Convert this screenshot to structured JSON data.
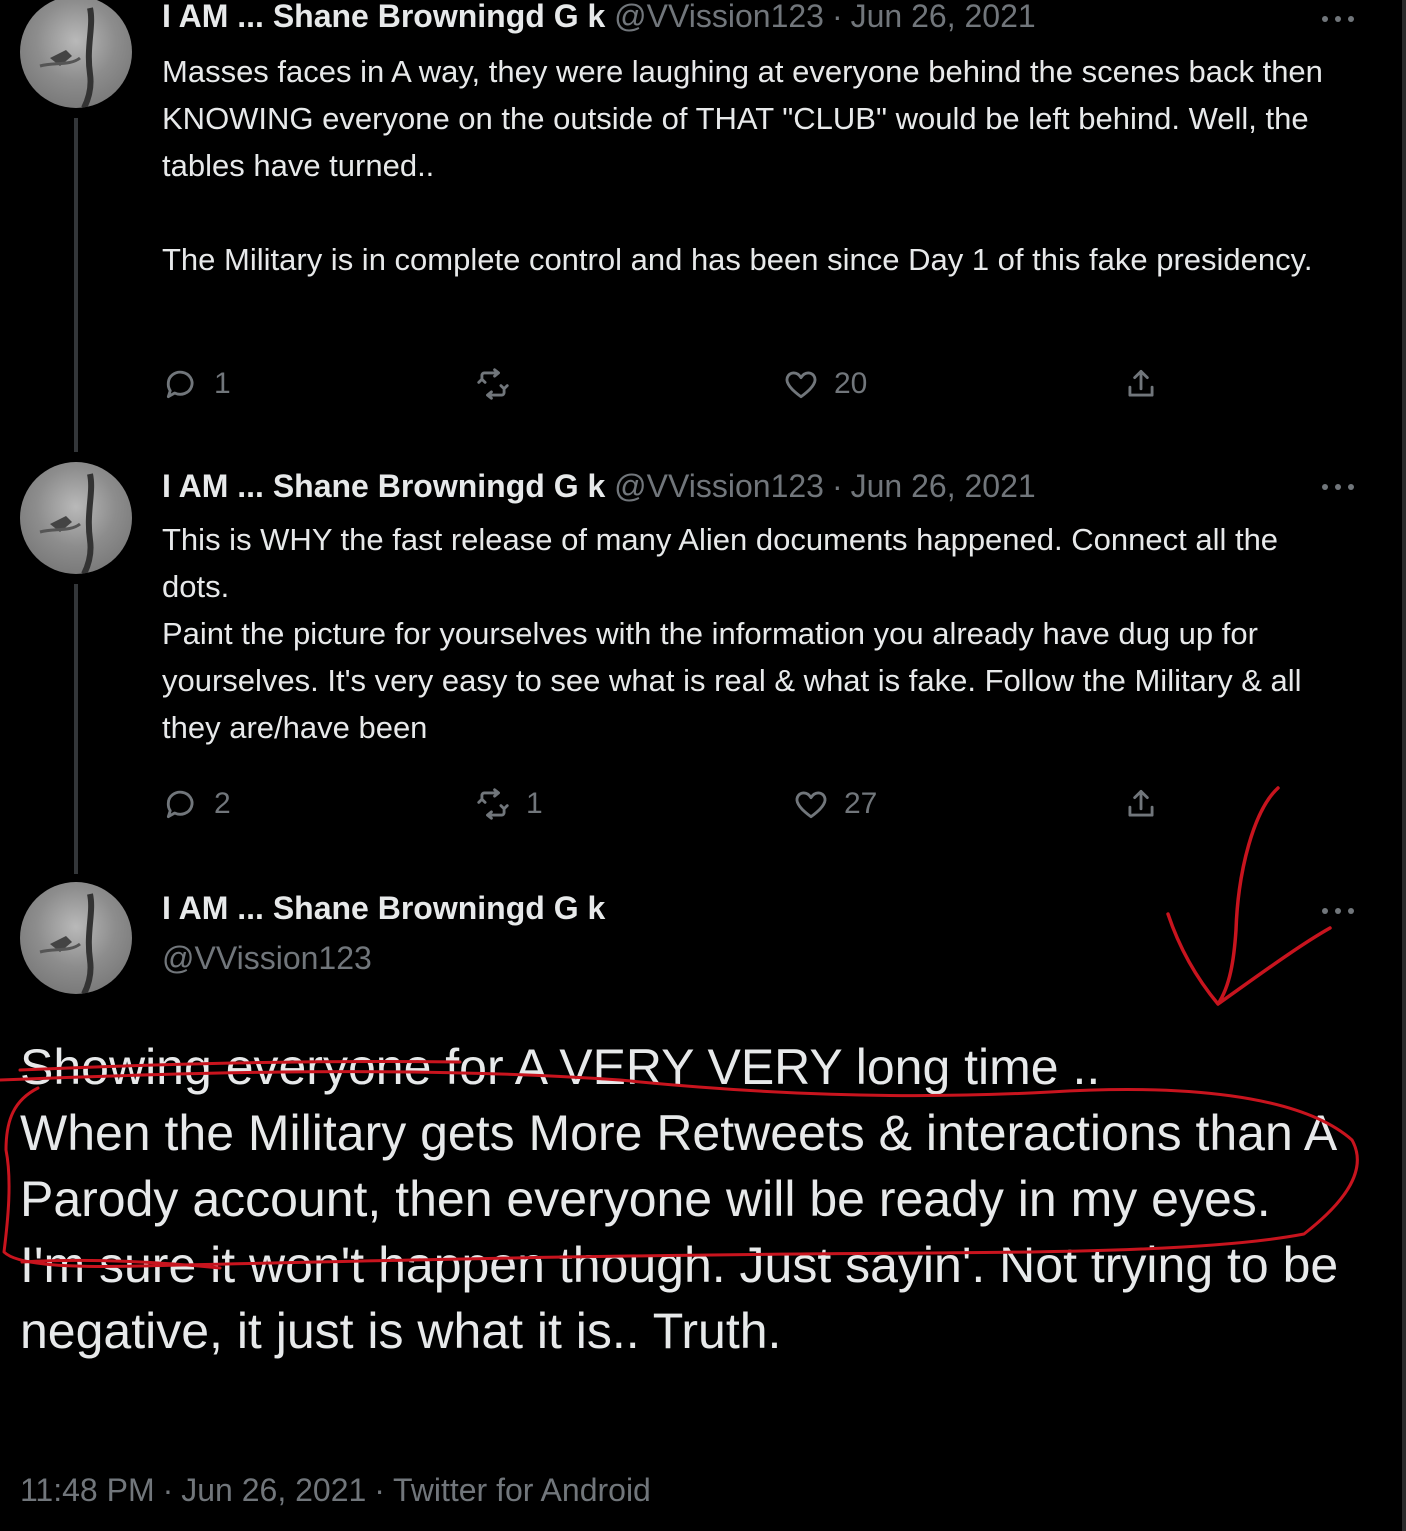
{
  "tweets": [
    {
      "display_name": "I AM ... Shane Browningd G k",
      "handle": "@VVission123",
      "date": "Jun 26, 2021",
      "text": [
        "Masses faces in A way, they were laughing at everyone behind the scenes back then KNOWING everyone on the outside of THAT \"CLUB\" would be left behind. Well, the tables have turned..",
        "The Military is in complete control and has been since Day 1 of this fake presidency."
      ],
      "replies": "1",
      "retweets": "",
      "likes": "20"
    },
    {
      "display_name": "I AM ... Shane Browningd G k",
      "handle": "@VVission123",
      "date": "Jun 26, 2021",
      "text": [
        "This is WHY the fast release of many Alien documents happened. Connect all the dots.",
        "Paint the picture for yourselves with the information you already have dug up for yourselves. It's very easy to see what is real & what is fake. Follow the Military & all they are/have been"
      ],
      "replies": "2",
      "retweets": "1",
      "likes": "27"
    }
  ],
  "main_tweet": {
    "display_name": "I AM ... Shane Browningd G k",
    "handle": "@VVission123",
    "text": [
      "Showing everyone for A VERY VERY long time ..",
      "When the Military gets More Retweets & interactions than A Parody account, then everyone will be ready in my eyes.",
      "I'm sure it won't happen though. Just sayin'. Not trying to be negative, it just is what it is.. Truth."
    ],
    "time": "11:48 PM",
    "date": "Jun 26, 2021",
    "source": "Twitter for Android"
  },
  "icons": [
    "reply-icon",
    "retweet-icon",
    "like-icon",
    "share-icon",
    "more-icon"
  ],
  "colors": {
    "background": "#000000",
    "text": "#e7e9ea",
    "secondary_text": "#71767b",
    "annotation": "#c8141e"
  }
}
